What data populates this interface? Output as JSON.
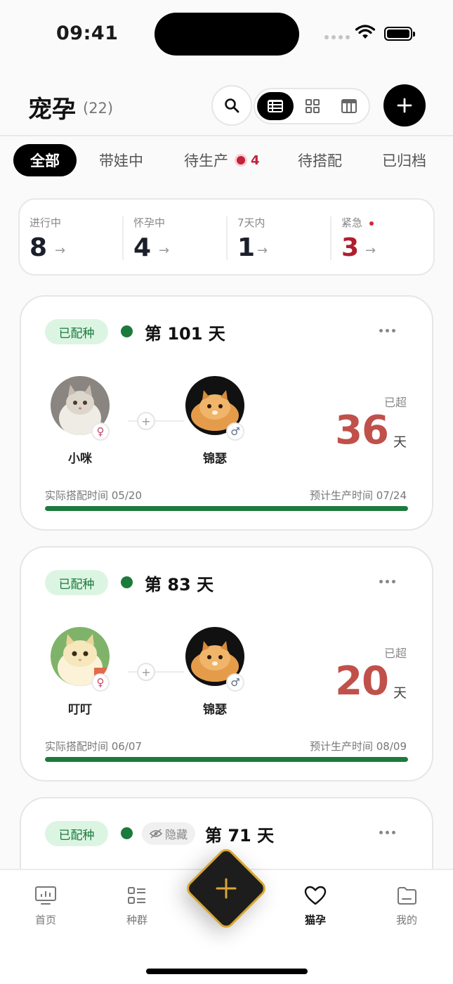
{
  "status_bar": {
    "time": "09:41"
  },
  "header": {
    "title": "宠孕",
    "count": "(22)"
  },
  "tabs": [
    {
      "label": "全部"
    },
    {
      "label": "带娃中"
    },
    {
      "label": "待生产",
      "badge": "4"
    },
    {
      "label": "待搭配"
    },
    {
      "label": "已归档"
    }
  ],
  "stats": [
    {
      "label": "进行中",
      "value": "8"
    },
    {
      "label": "怀孕中",
      "value": "4"
    },
    {
      "label": "7天内",
      "value": "1"
    },
    {
      "label": "紧急",
      "value": "3"
    }
  ],
  "cards": [
    {
      "status": "已配种",
      "day": "第 101 天",
      "female": {
        "name": "小咪"
      },
      "male": {
        "name": "锦瑟"
      },
      "over_label": "已超",
      "over_value": "36",
      "over_unit": "天",
      "mate_time": "实际搭配时间 05/20",
      "due_time": "预计生产时间 07/24",
      "progress": 1.0
    },
    {
      "status": "已配种",
      "day": "第 83 天",
      "female": {
        "name": "叮叮"
      },
      "male": {
        "name": "锦瑟"
      },
      "over_label": "已超",
      "over_value": "20",
      "over_unit": "天",
      "mate_time": "实际搭配时间 06/07",
      "due_time": "预计生产时间 08/09",
      "progress": 1.0
    },
    {
      "status": "已配种",
      "hidden_tag": "隐藏",
      "day": "第 71 天"
    }
  ],
  "nav": [
    {
      "label": "首页",
      "icon": "monitor-icon"
    },
    {
      "label": "种群",
      "icon": "list-icon"
    },
    {
      "label": "猫孕",
      "icon": "heart-icon"
    },
    {
      "label": "我的",
      "icon": "folder-icon"
    }
  ],
  "colors": {
    "accent": "#000000",
    "status_green": "#1c7a3c",
    "badge_bg": "#dcf5e3",
    "over_red": "#c0504a",
    "urgent_red": "#b01e2d",
    "fab_border": "#d8a736"
  }
}
